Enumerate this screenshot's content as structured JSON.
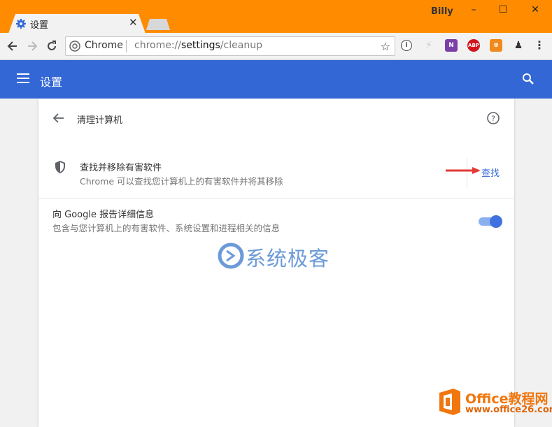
{
  "browser": {
    "tab_title": "设置",
    "user_name": "Billy",
    "omnibox": {
      "scheme_label": "Chrome",
      "url_prefix": "chrome://",
      "url_host": "settings",
      "url_path": "/cleanup"
    },
    "extensions": [
      "i",
      "ABP"
    ]
  },
  "appbar": {
    "title": "设置"
  },
  "page": {
    "title": "清理计算机",
    "find_row": {
      "title": "查找并移除有害软件",
      "subtitle": "Chrome 可以查找您计算机上的有害软件并将其移除",
      "action": "查找"
    },
    "report_row": {
      "title": "向 Google 报告详细信息",
      "subtitle": "包含与您计算机上的有害软件、系统设置和进程相关的信息",
      "toggle_on": true
    }
  },
  "watermark": {
    "text": "系统极客"
  },
  "corner_logo": {
    "line1": "Office教程网",
    "line2": "www.office26.com"
  },
  "colors": {
    "titlebar": "#ff8c00",
    "appbar": "#3367d6",
    "link": "#3367d6"
  }
}
